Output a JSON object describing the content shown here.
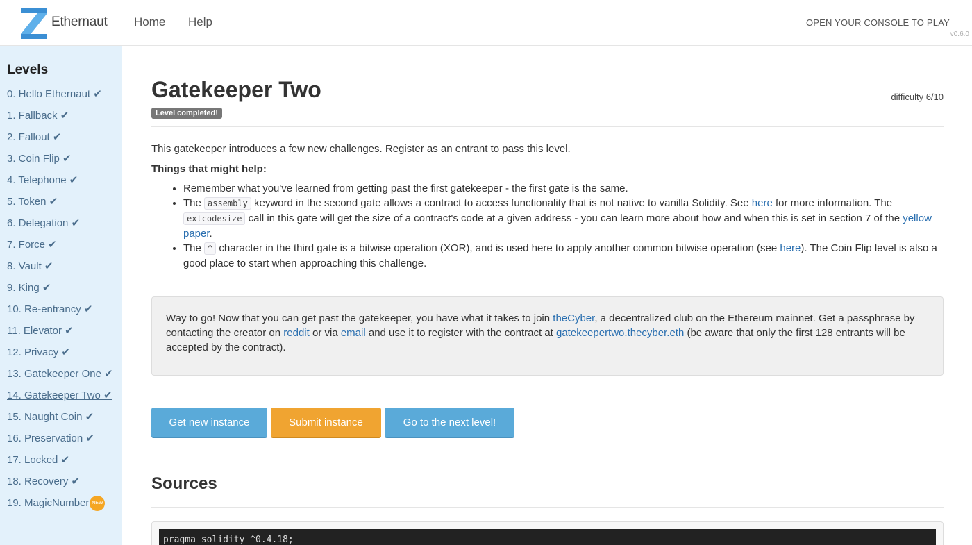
{
  "nav": {
    "brand": "Ethernaut",
    "home": "Home",
    "help": "Help",
    "console": "OPEN YOUR CONSOLE TO PLAY",
    "version": "v0.6.0"
  },
  "sidebar": {
    "title": "Levels",
    "items": [
      {
        "label": "0. Hello Ethernaut ✔"
      },
      {
        "label": "1. Fallback ✔"
      },
      {
        "label": "2. Fallout ✔"
      },
      {
        "label": "3. Coin Flip ✔"
      },
      {
        "label": "4. Telephone ✔"
      },
      {
        "label": "5. Token ✔"
      },
      {
        "label": "6. Delegation ✔"
      },
      {
        "label": "7. Force ✔"
      },
      {
        "label": "8. Vault ✔"
      },
      {
        "label": "9. King ✔"
      },
      {
        "label": "10. Re-entrancy ✔"
      },
      {
        "label": "11. Elevator ✔"
      },
      {
        "label": "12. Privacy ✔"
      },
      {
        "label": "13. Gatekeeper One ✔"
      },
      {
        "label": "14. Gatekeeper Two ✔"
      },
      {
        "label": "15. Naught Coin ✔"
      },
      {
        "label": "16. Preservation ✔"
      },
      {
        "label": "17. Locked ✔"
      },
      {
        "label": "18. Recovery ✔"
      },
      {
        "label": "19. MagicNumber"
      }
    ],
    "new_badge": "NEW"
  },
  "level": {
    "title": "Gatekeeper Two",
    "status": "Level completed!",
    "difficulty": "difficulty 6/10"
  },
  "content": {
    "description": "This gatekeeper introduces a few new challenges. Register as an entrant to pass this level.",
    "helps_heading": "Things that might help:",
    "tip1": "Remember what you've learned from getting past the first gatekeeper - the first gate is the same.",
    "tip2_a": "The ",
    "tip2_code1": "assembly",
    "tip2_b": " keyword in the second gate allows a contract to access functionality that is not native to vanilla Solidity. See ",
    "tip2_link1": "here",
    "tip2_c": " for more information. The ",
    "tip2_code2": "extcodesize",
    "tip2_d": " call in this gate will get the size of a contract's code at a given address - you can learn more about how and when this is set in section 7 of the ",
    "tip2_link2": "yellow paper",
    "tip2_e": ".",
    "tip3_a": "The ",
    "tip3_code": "^",
    "tip3_b": " character in the third gate is a bitwise operation (XOR), and is used here to apply another common bitwise operation (see ",
    "tip3_link": "here",
    "tip3_c": "). The Coin Flip level is also a good place to start when approaching this challenge."
  },
  "info": {
    "a": "Way to go! Now that you can get past the gatekeeper, you have what it takes to join ",
    "link1": "theCyber",
    "b": ", a decentralized club on the Ethereum mainnet. Get a passphrase by contacting the creator on ",
    "link2": "reddit",
    "c": " or via ",
    "link3": "email",
    "d": " and use it to register with the contract at ",
    "link4": "gatekeepertwo.thecyber.eth",
    "e": " (be aware that only the first 128 entrants will be accepted by the contract)."
  },
  "buttons": {
    "new_instance": "Get new instance",
    "submit": "Submit instance",
    "next": "Go to the next level!"
  },
  "sources": {
    "heading": "Sources",
    "code_line": "pragma solidity ^0.4.18;"
  },
  "colors": {
    "sidebar_bg": "#e3f1fb",
    "link": "#2a6fb0",
    "button_blue": "#5aaad9",
    "button_orange": "#f0a431",
    "badge_gray": "#777777"
  }
}
